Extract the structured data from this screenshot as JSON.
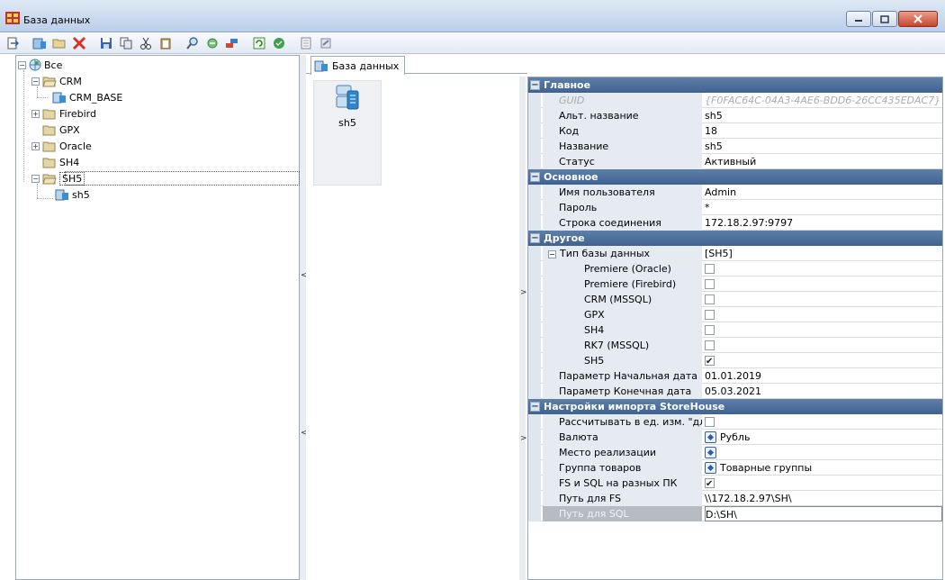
{
  "window": {
    "title": "База данных"
  },
  "tree": {
    "root": "Все",
    "items": [
      {
        "label": "CRM"
      },
      {
        "label": "CRM_BASE"
      },
      {
        "label": "Firebird"
      },
      {
        "label": "GPX"
      },
      {
        "label": "Oracle"
      },
      {
        "label": "SH4"
      },
      {
        "label": "SH5"
      },
      {
        "label": "sh5"
      }
    ]
  },
  "tab": {
    "label": "База данных"
  },
  "tile": {
    "label": "sh5"
  },
  "grid": {
    "cat_main": "Главное",
    "guid": {
      "name": "GUID",
      "value": "{F0FAC64C-04A3-4AE6-BDD6-26CC435EDAC7}"
    },
    "alt_name": {
      "name": "Альт. название",
      "value": "sh5"
    },
    "code": {
      "name": "Код",
      "value": "18"
    },
    "name": {
      "name": "Название",
      "value": "sh5"
    },
    "status": {
      "name": "Статус",
      "value": "Активный"
    },
    "cat_basic": "Основное",
    "user": {
      "name": "Имя пользователя",
      "value": "Admin"
    },
    "password": {
      "name": "Пароль",
      "value": "*"
    },
    "conn": {
      "name": "Строка соединения",
      "value": "172.18.2.97:9797"
    },
    "cat_other": "Другое",
    "dbtype": {
      "name": "Тип базы данных",
      "value": "[SH5]"
    },
    "opt_premiere_oracle": {
      "name": "Premiere (Oracle)",
      "checked": false
    },
    "opt_premiere_firebird": {
      "name": "Premiere (Firebird)",
      "checked": false
    },
    "opt_crm": {
      "name": "CRM (MSSQL)",
      "checked": false
    },
    "opt_gpx": {
      "name": "GPX",
      "checked": false
    },
    "opt_sh4": {
      "name": "SH4",
      "checked": false
    },
    "opt_rk7": {
      "name": "RK7 (MSSQL)",
      "checked": false
    },
    "opt_sh5": {
      "name": "SH5",
      "checked": true
    },
    "start_date": {
      "name": "Параметр Начальная дата",
      "value": "01.01.2019"
    },
    "end_date": {
      "name": "Параметр Конечная дата",
      "value": "05.03.2021"
    },
    "cat_import": "Настройки импорта StoreHouse",
    "calc_units": {
      "name": "Рассчитывать в ед. изм. \"дл",
      "checked": false
    },
    "currency": {
      "name": "Валюта",
      "value": "Рубль"
    },
    "place": {
      "name": "Место реализации",
      "value": ""
    },
    "goods_group": {
      "name": "Группа товаров",
      "value": "Товарные группы"
    },
    "fs_sql": {
      "name": "FS и SQL на разных ПК",
      "checked": true
    },
    "fs_path": {
      "name": "Путь для FS",
      "value": "\\\\172.18.2.97\\SH\\"
    },
    "sql_path": {
      "name": "Путь для SQL",
      "value": "D:\\SH\\"
    }
  },
  "colors": {
    "category_bg": "#4a6d9b",
    "name_col_bg": "#e6ebf1",
    "folder": "#d9c48a"
  }
}
